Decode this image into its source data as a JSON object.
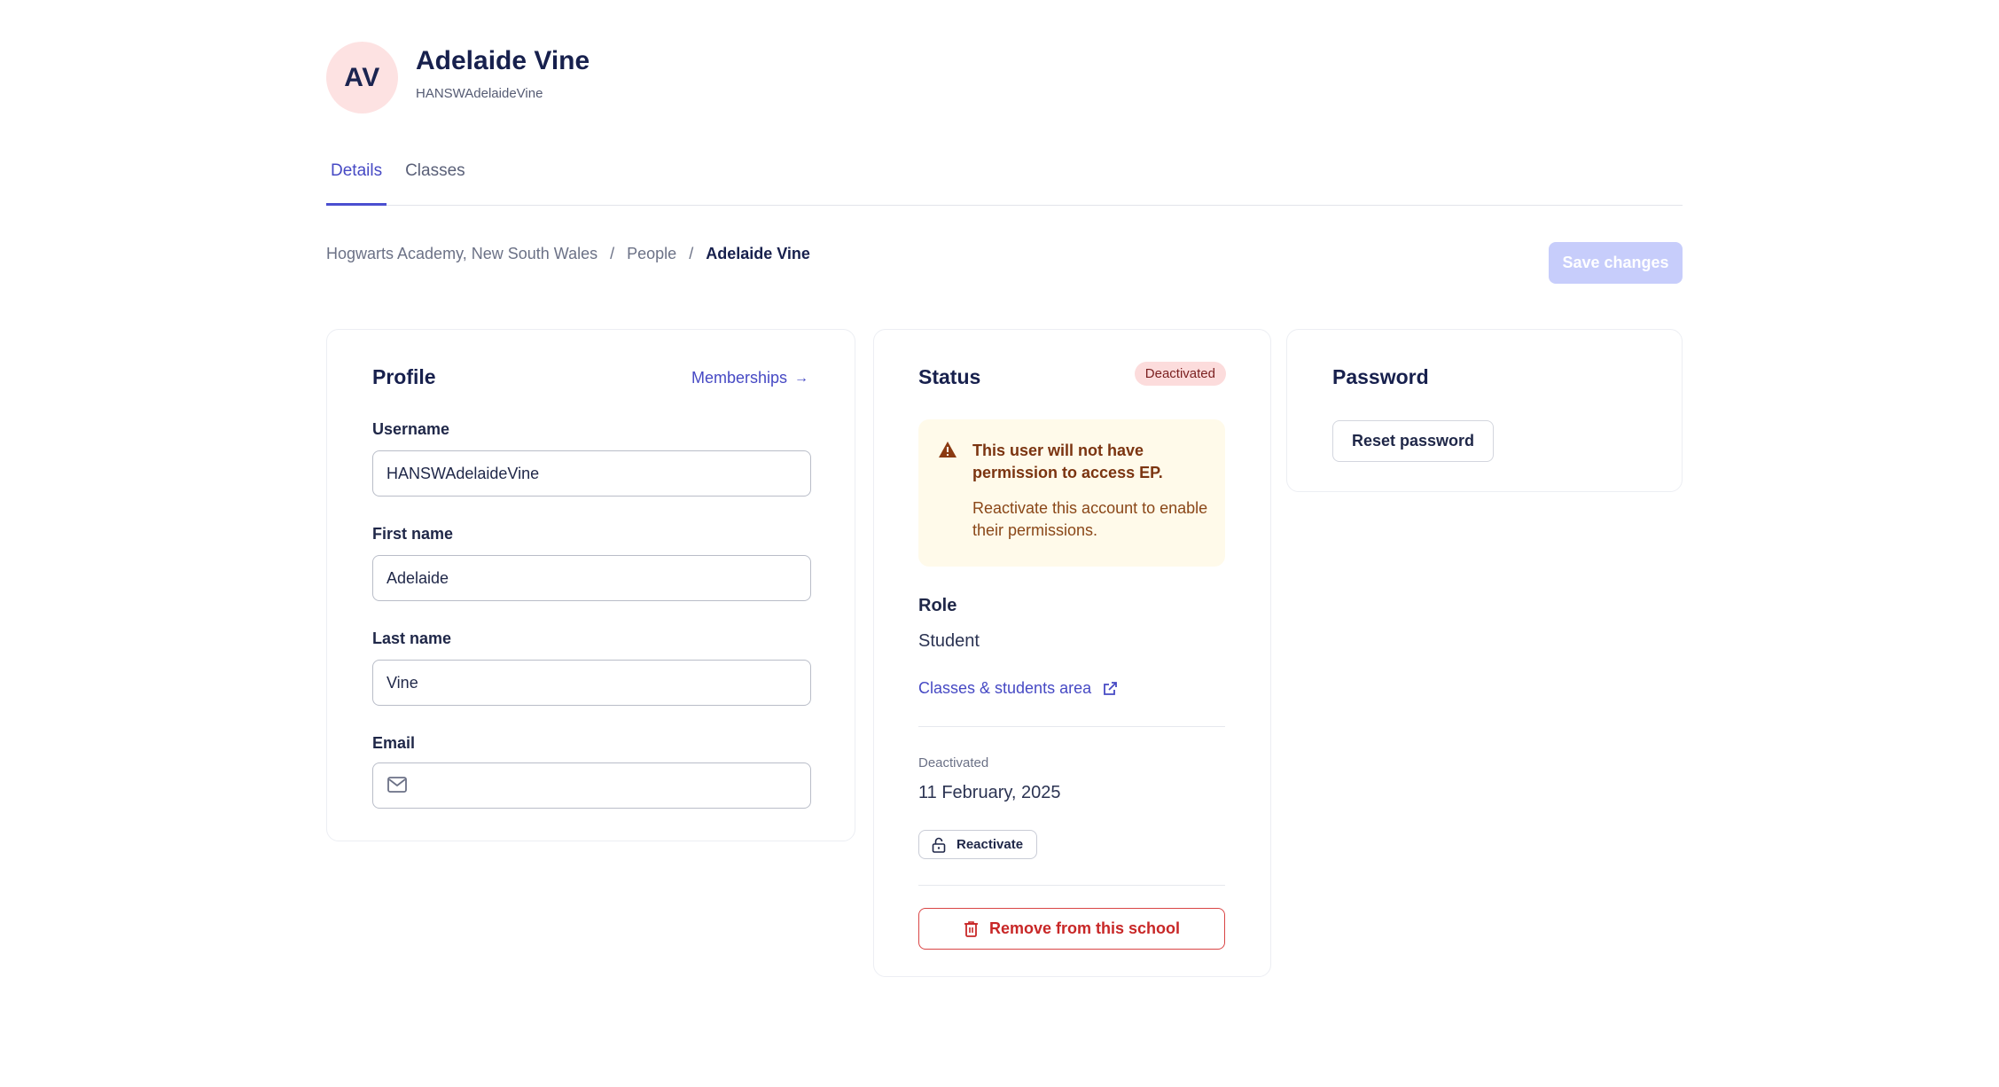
{
  "user": {
    "initials": "AV",
    "name": "Adelaide Vine",
    "handle": "HANSWAdelaideVine"
  },
  "tabs": [
    {
      "label": "Details",
      "active": true
    },
    {
      "label": "Classes",
      "active": false
    }
  ],
  "breadcrumb": {
    "school": "Hogwarts Academy, New South Wales",
    "people": "People",
    "current": "Adelaide Vine",
    "separator": "/"
  },
  "toolbar": {
    "save_label": "Save changes"
  },
  "profile": {
    "title": "Profile",
    "memberships_label": "Memberships",
    "username_label": "Username",
    "username_value": "HANSWAdelaideVine",
    "first_name_label": "First name",
    "first_name_value": "Adelaide",
    "last_name_label": "Last name",
    "last_name_value": "Vine",
    "email_label": "Email",
    "email_value": ""
  },
  "status": {
    "title": "Status",
    "badge": "Deactivated",
    "alert_title": "This user will not have permission to access EP.",
    "alert_body": "Reactivate this account to enable their permissions.",
    "role_label": "Role",
    "role_value": "Student",
    "classes_link": "Classes & students area",
    "deactivated_label": "Deactivated",
    "deactivated_date": "11 February, 2025",
    "reactivate_label": "Reactivate",
    "remove_label": "Remove from this school"
  },
  "password": {
    "title": "Password",
    "reset_label": "Reset password"
  },
  "colors": {
    "accent": "#4649c4",
    "danger": "#c82727",
    "warning_bg": "#fffaea",
    "badge_bg": "#fcdcdc",
    "avatar_bg": "#fde2e2"
  }
}
